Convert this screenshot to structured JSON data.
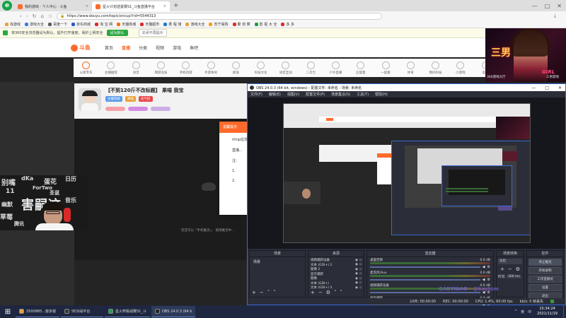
{
  "browser": {
    "tabs": [
      {
        "label": "我的游戏 · 个人中心 · 斗鱼",
        "active": false
      },
      {
        "label": "星火计划选拔赛S1_斗鱼直播平台",
        "active": true
      }
    ],
    "new_tab_glyph": "+",
    "url": "https://www.douyu.com/topic/xncup?rid=5544313",
    "bookmarks": [
      "找游戏",
      "游戏大全",
      "百度一下",
      "京东商城",
      "淘 宝 网",
      "天猫商城",
      "天猫超市",
      "携 程 旅",
      "游戏大全",
      "苏宁易购",
      "聚 划 算",
      "影 视 大 全",
      "多 多"
    ],
    "infobar": {
      "text": "将360安全浏览器设为默认，提升打开速度，保护上网安全",
      "button": "设为默认",
      "dismiss": "关闭不再提示"
    }
  },
  "douyu": {
    "logo": "斗鱼",
    "nav": [
      "首页",
      "直播",
      "分类",
      "视频",
      "游戏",
      "鱼吧"
    ],
    "categories": [
      "火箭专车",
      "主播推荐",
      "语音",
      "网游竞技",
      "单机热游",
      "手游休闲",
      "颜值",
      "科技文化",
      "语音互动",
      "二次元",
      "户外直播",
      "正能量",
      "一起看",
      "体育",
      "数码科技",
      "小游戏",
      "美食"
    ],
    "stream_title": "【不到120斤不改标题】 果喵 我宝",
    "host_tags": [
      "主播等级",
      "果喵",
      "天气好"
    ],
    "modal_title": "温馨提示",
    "modal_lines": [
      "rtmp拉流",
      "直播...",
      "注：",
      "1.",
      "2."
    ],
    "footer_note": "您还可以『手机推流』， 极限推流中..."
  },
  "overlay": {
    "banner_text": "三男",
    "banner_sub": "GIRL",
    "caption": "300游戏大厅",
    "sub_caption": "三男游戏"
  },
  "obs": {
    "title": "OBS 24.0.3 (64 bit, windows) - 配置文件: 未命名 - 场景: 未命名",
    "menu": [
      "文件(F)",
      "编辑(E)",
      "视图(V)",
      "配置文件(P)",
      "场景集合(S)",
      "工具(T)",
      "帮助(H)"
    ],
    "panels": {
      "scenes": {
        "title": "场景",
        "items": [
          "场景"
        ]
      },
      "sources": {
        "title": "来源",
        "items": [
          "视频捕获设备",
          "文本 (GDI+) 2",
          "图像 2",
          "显示捕获",
          "图像",
          "文本 (GDI+)",
          "文本 (GDI+) 3"
        ]
      },
      "mixer": {
        "title": "混音器",
        "tracks": [
          {
            "name": "桌面音频",
            "db": "0.0 dB"
          },
          {
            "name": "麦克风/Aux",
            "db": "0.0 dB"
          },
          {
            "name": "视频捕获设备",
            "db": "0.0 dB"
          },
          {
            "name": "显示捕获",
            "db": "0.0 dB"
          }
        ]
      },
      "transitions": {
        "title": "场景转换",
        "selected": "淡出",
        "duration_label": "时长",
        "duration_value": "300 ms"
      },
      "controls": {
        "title": "控件",
        "buttons": [
          "停止推流",
          "开始录制",
          "工作室模式",
          "设置",
          "退出"
        ]
      }
    },
    "status": {
      "live": "LIVE: 00:00:00",
      "rec": "REC: 00:00:00",
      "cpu": "CPU: 1.4%, 60.00 fps",
      "kbps": "kb/s: 0 帧丢失"
    },
    "watermark": "GABYNIAO - @kaytom"
  },
  "webcam": {
    "graffiti_words": [
      "别嘴",
      "dKa",
      "蛋花",
      "日历",
      "11",
      "幽默",
      "圣诞",
      "草莓",
      "腾讯",
      "音乐",
      "ForTwo"
    ],
    "big_word": "害嗣这"
  },
  "taskbar": {
    "start_glyph": "⊞",
    "items": [
      "2500885...窗多窗口...",
      "5E对战平台",
      "星火杯挑战赛S1_斗...",
      "OBS 24.0.3 (64 bit..."
    ],
    "clock_time": "15:34:24",
    "clock_date": "2021/11/19",
    "tray": [
      "^",
      "英",
      "中"
    ]
  },
  "colors": {
    "douyu_orange": "#ff6a2b",
    "obs_bg": "#2b2e38",
    "taskbar_bg": "#1f2740",
    "infobar_green": "#2aa844"
  }
}
